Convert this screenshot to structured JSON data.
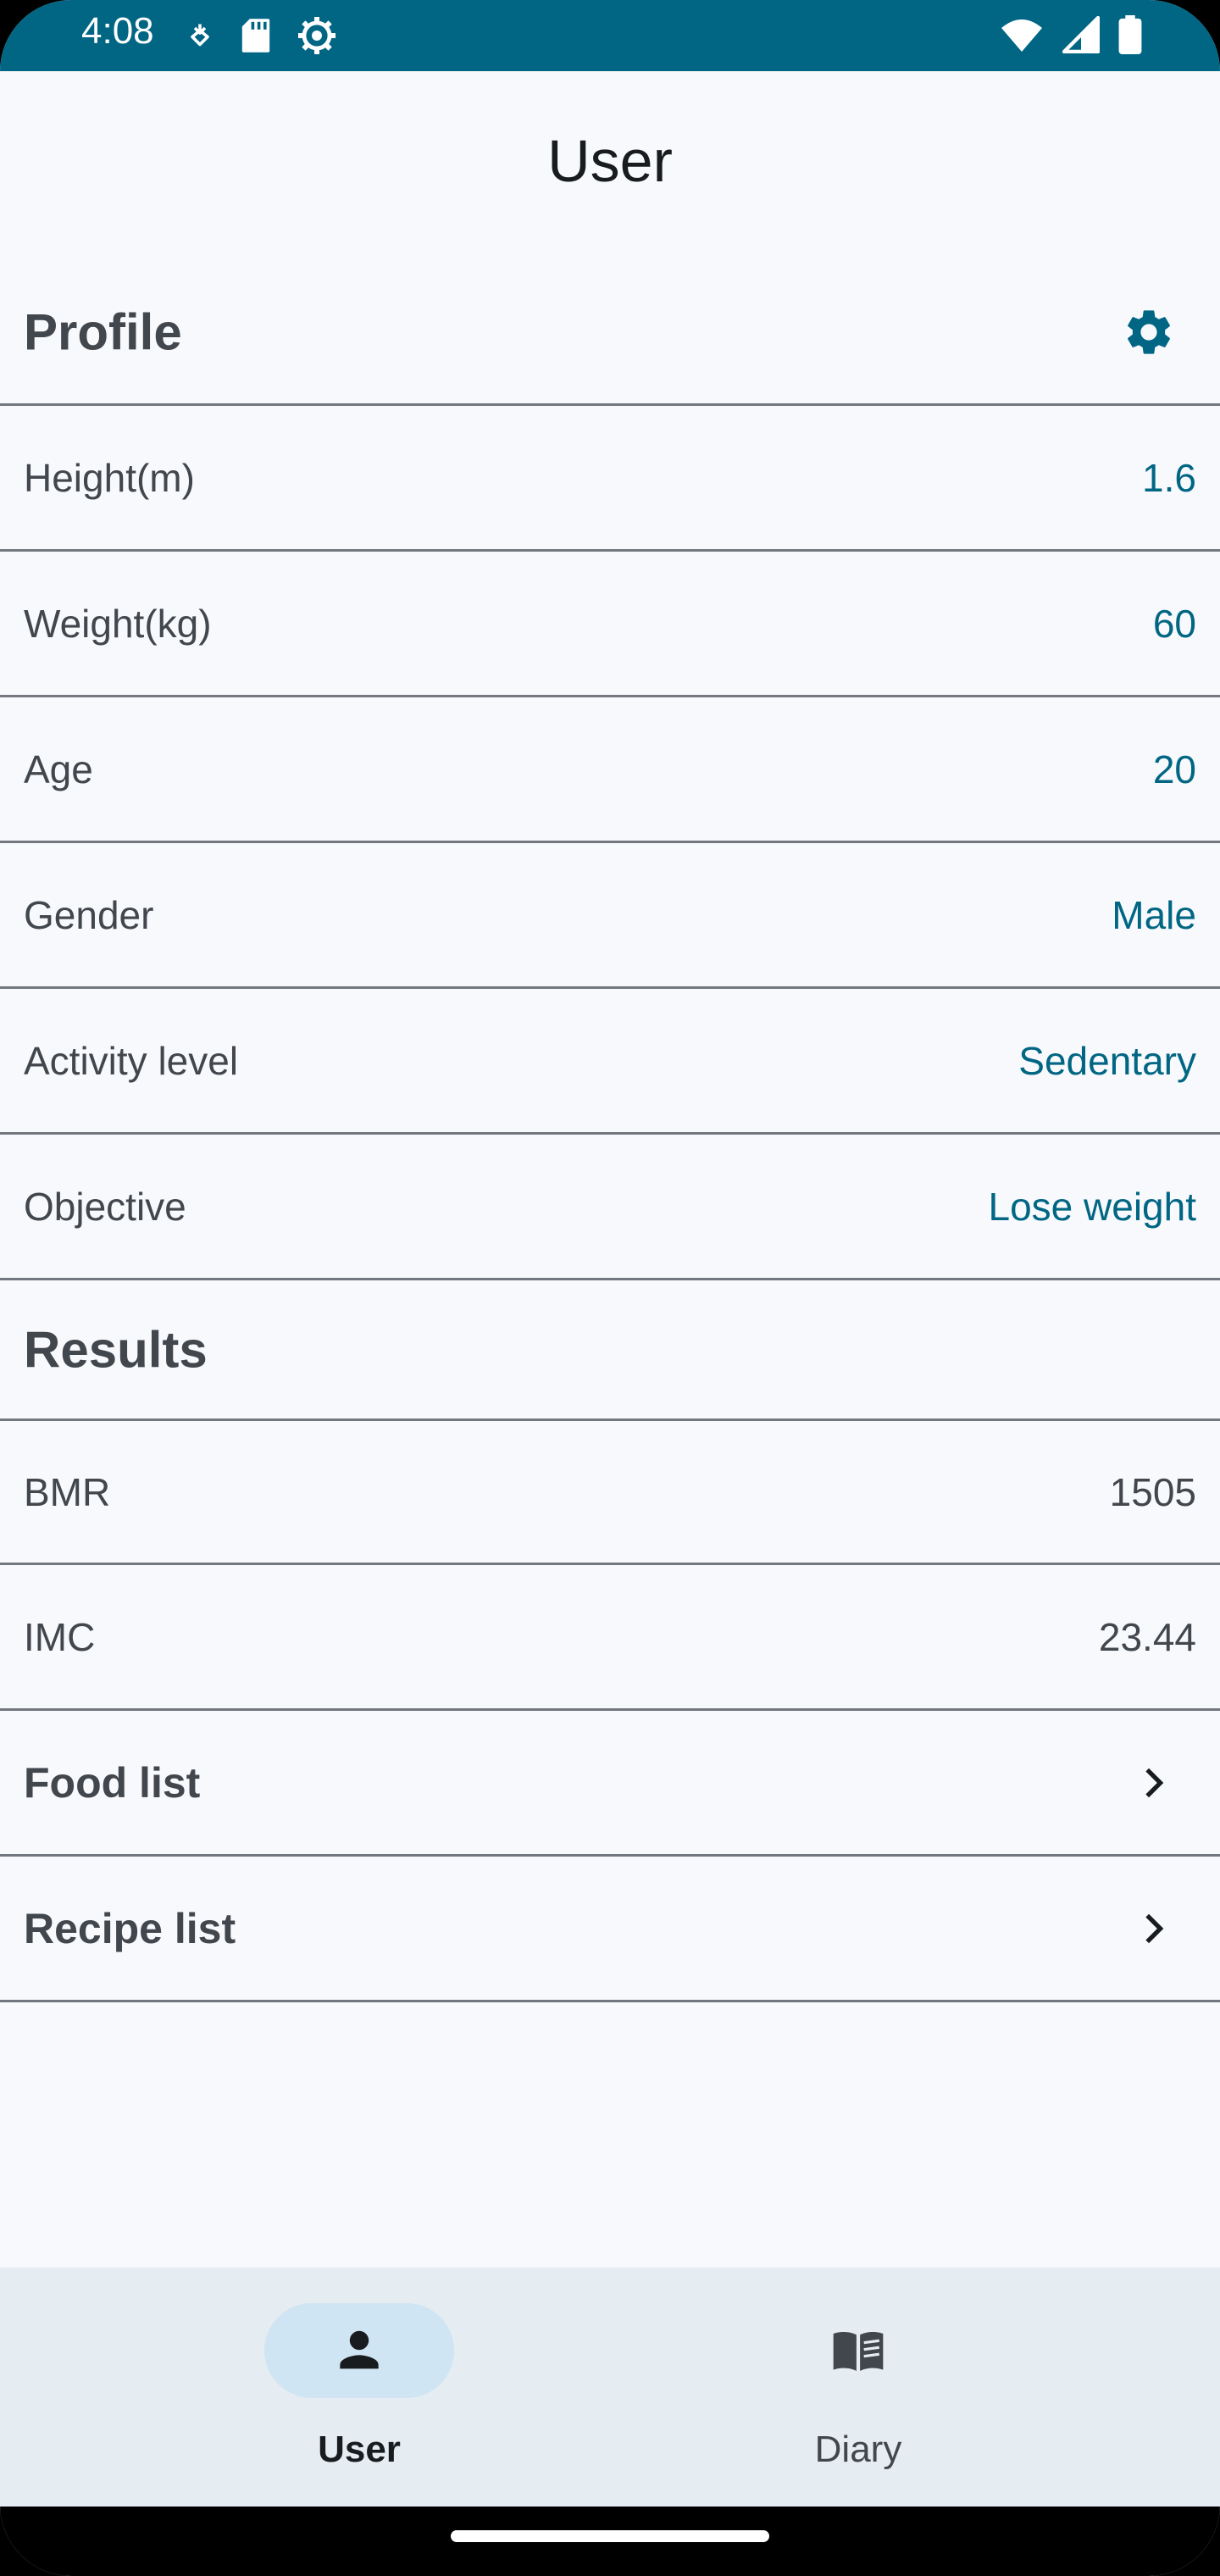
{
  "status_bar": {
    "time": "4:08",
    "left_icons": [
      "data-saver-icon",
      "sd-card-icon",
      "settings-gear-icon"
    ],
    "right_icons": [
      "wifi-icon",
      "signal-icon",
      "battery-icon"
    ]
  },
  "app_bar": {
    "title": "User"
  },
  "profile": {
    "heading": "Profile",
    "settings_icon": "gear-icon",
    "fields": [
      {
        "label": "Height(m)",
        "value": "1.6"
      },
      {
        "label": "Weight(kg)",
        "value": "60"
      },
      {
        "label": "Age",
        "value": "20"
      },
      {
        "label": "Gender",
        "value": "Male"
      },
      {
        "label": "Activity level",
        "value": "Sedentary"
      },
      {
        "label": "Objective",
        "value": "Lose weight"
      }
    ]
  },
  "results": {
    "heading": "Results",
    "items": [
      {
        "label": "BMR",
        "value": "1505"
      },
      {
        "label": "IMC",
        "value": "23.44"
      }
    ]
  },
  "links": [
    {
      "label": "Food list",
      "icon": "chevron-right-icon"
    },
    {
      "label": "Recipe list",
      "icon": "chevron-right-icon"
    }
  ],
  "bottom_nav": {
    "items": [
      {
        "label": "User",
        "icon": "person-icon",
        "active": true
      },
      {
        "label": "Diary",
        "icon": "book-icon",
        "active": false
      }
    ]
  },
  "colors": {
    "status_bar": "#006684",
    "accent_value": "#006684",
    "background": "#f8f9fc",
    "nav_background": "#e5ecf2",
    "nav_active_pill": "#cfe5f3"
  }
}
